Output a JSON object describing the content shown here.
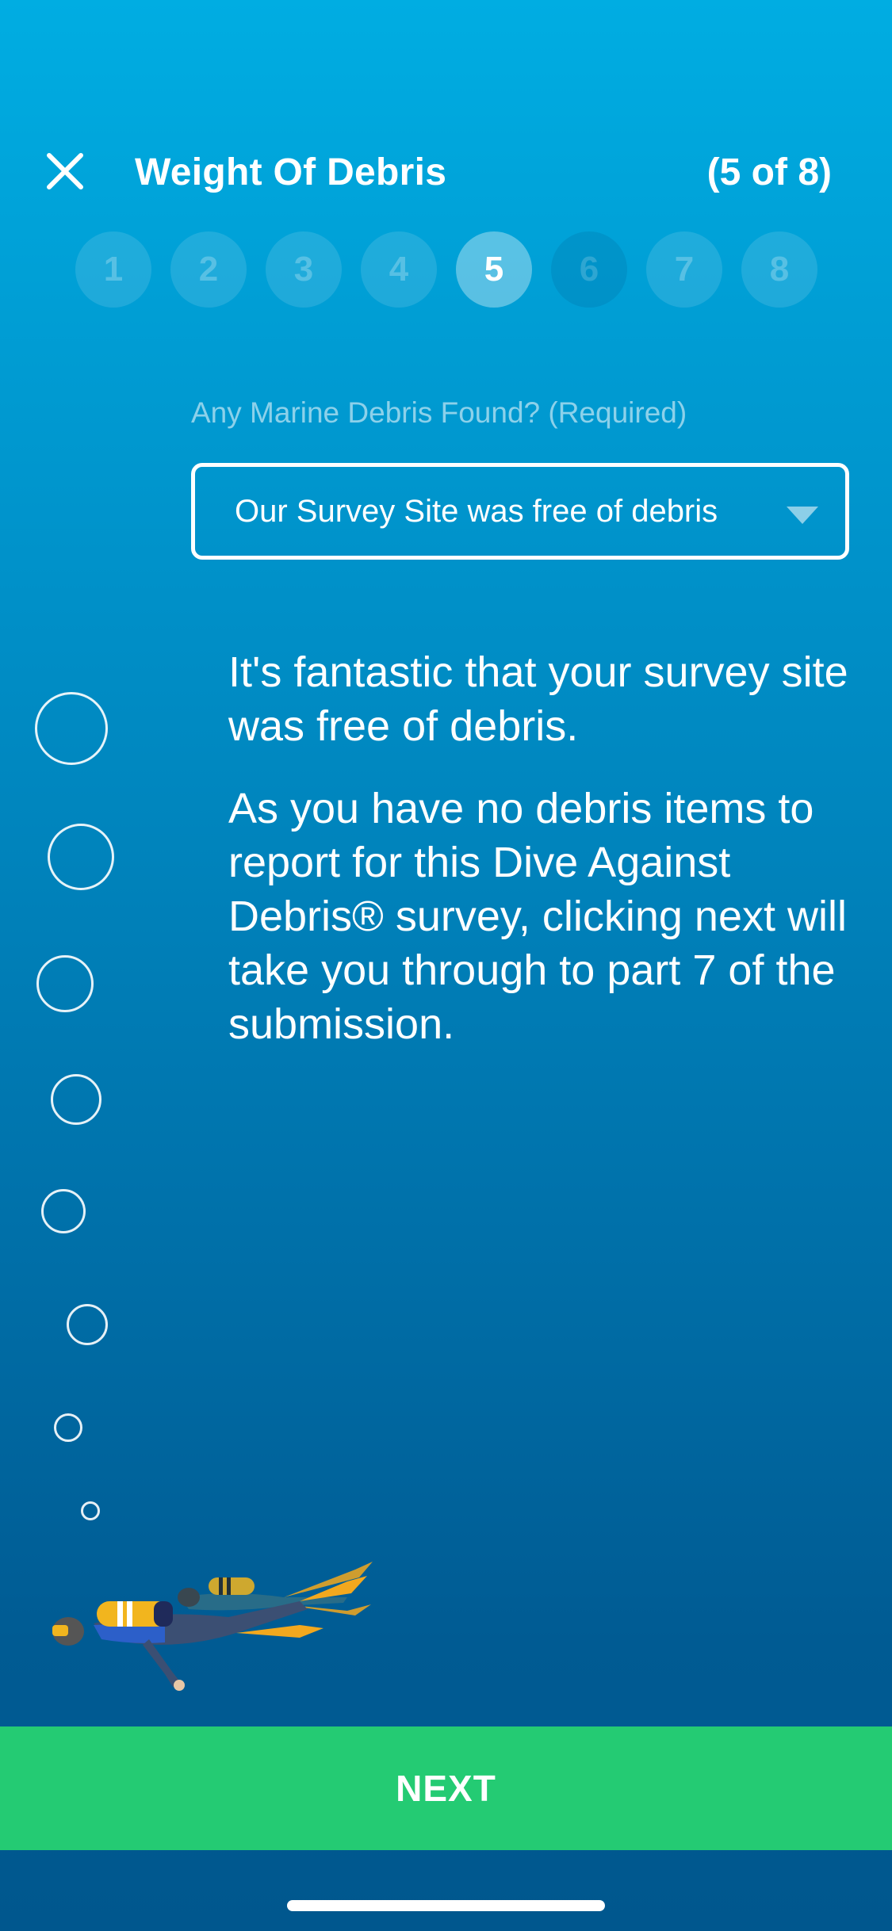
{
  "header": {
    "title": "Weight Of Debris",
    "progress": "(5 of 8)",
    "close_icon": "close-icon"
  },
  "steps": {
    "items": [
      "1",
      "2",
      "3",
      "4",
      "5",
      "6",
      "7",
      "8"
    ],
    "current": 5
  },
  "form": {
    "label": "Any Marine Debris Found? (Required)",
    "selected_value": "Our Survey Site was free of debris",
    "dropdown_icon": "chevron-down-icon"
  },
  "message": {
    "paragraph1": "It's fantastic that your survey site was free of debris.",
    "paragraph2": "As you have no debris items to report for this Dive Against Debris® survey, clicking next will take you through to part 7 of the submission."
  },
  "illustration": {
    "icon": "scuba-divers-illustration",
    "bubbles_icon": "bubble-icon"
  },
  "footer": {
    "next_label": "NEXT"
  },
  "colors": {
    "accent_green": "#24cb73",
    "bg_top": "#00ade2",
    "bg_bottom": "#00578e"
  }
}
